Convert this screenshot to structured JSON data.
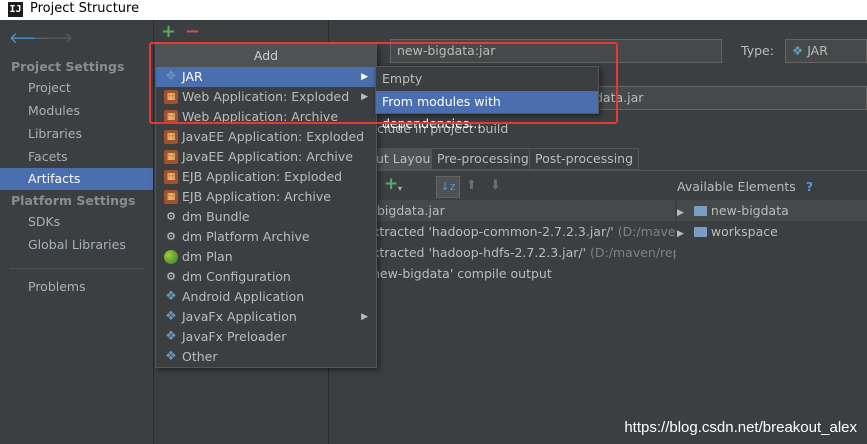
{
  "window": {
    "app_icon": "IJ",
    "title": "Project Structure"
  },
  "nav": {
    "project_settings_header": "Project Settings",
    "platform_settings_header": "Platform Settings",
    "items": [
      "Project",
      "Modules",
      "Libraries",
      "Facets",
      "Artifacts"
    ],
    "platform_items": [
      "SDKs",
      "Global Libraries"
    ],
    "problems": "Problems",
    "selected": "Artifacts"
  },
  "toolbar": {
    "add": "+",
    "remove": "−"
  },
  "artifact": {
    "name_value": "new-bigdata:jar",
    "type_label": "Type:",
    "type_value": "JAR",
    "output_dir_partial": "data.jar",
    "include_label": "clude in project build"
  },
  "tabs": [
    "ut Layout",
    "Pre-processing",
    "Post-processing"
  ],
  "layout_tree": [
    {
      "text": "bigdata.jar",
      "path": ""
    },
    {
      "text": "xtracted 'hadoop-common-2.7.2.3.jar/'",
      "path": " (D:/maven/re"
    },
    {
      "text": "xtracted 'hadoop-hdfs-2.7.2.3.jar/'",
      "path": " (D:/maven/repo/c"
    },
    {
      "text": "new-bigdata' compile output",
      "path": ""
    }
  ],
  "available": {
    "label": "Available Elements",
    "help": "?",
    "items": [
      "new-bigdata",
      "workspace"
    ]
  },
  "add_menu": {
    "header": "Add",
    "items": [
      {
        "label": "JAR",
        "icon": "diamond-icon",
        "submenu": true,
        "highlighted": true
      },
      {
        "label": "Web Application: Exploded",
        "icon": "gift-icon",
        "submenu": true
      },
      {
        "label": "Web Application: Archive",
        "icon": "gift-icon"
      },
      {
        "label": "JavaEE Application: Exploded",
        "icon": "gift-icon"
      },
      {
        "label": "JavaEE Application: Archive",
        "icon": "gift-icon"
      },
      {
        "label": "EJB Application: Exploded",
        "icon": "gift-icon"
      },
      {
        "label": "EJB Application: Archive",
        "icon": "gift-icon"
      },
      {
        "label": "dm Bundle",
        "icon": "gear-icon"
      },
      {
        "label": "dm Platform Archive",
        "icon": "gear-icon"
      },
      {
        "label": "dm Plan",
        "icon": "globe-icon"
      },
      {
        "label": "dm Configuration",
        "icon": "gear-icon"
      },
      {
        "label": "Android Application",
        "icon": "android-icon"
      },
      {
        "label": "JavaFx Application",
        "icon": "diamond-icon",
        "submenu": true
      },
      {
        "label": "JavaFx Preloader",
        "icon": "diamond-icon"
      },
      {
        "label": "Other",
        "icon": "diamond-icon"
      }
    ]
  },
  "jar_submenu": {
    "items": [
      {
        "label": "Empty"
      },
      {
        "label": "From modules with dependencies...",
        "highlighted": true
      }
    ]
  },
  "watermark": "https://blog.csdn.net/breakout_alex",
  "colors": {
    "selection": "#4b6eaf",
    "annotation": "#e53935",
    "background": "#3c3f41"
  }
}
